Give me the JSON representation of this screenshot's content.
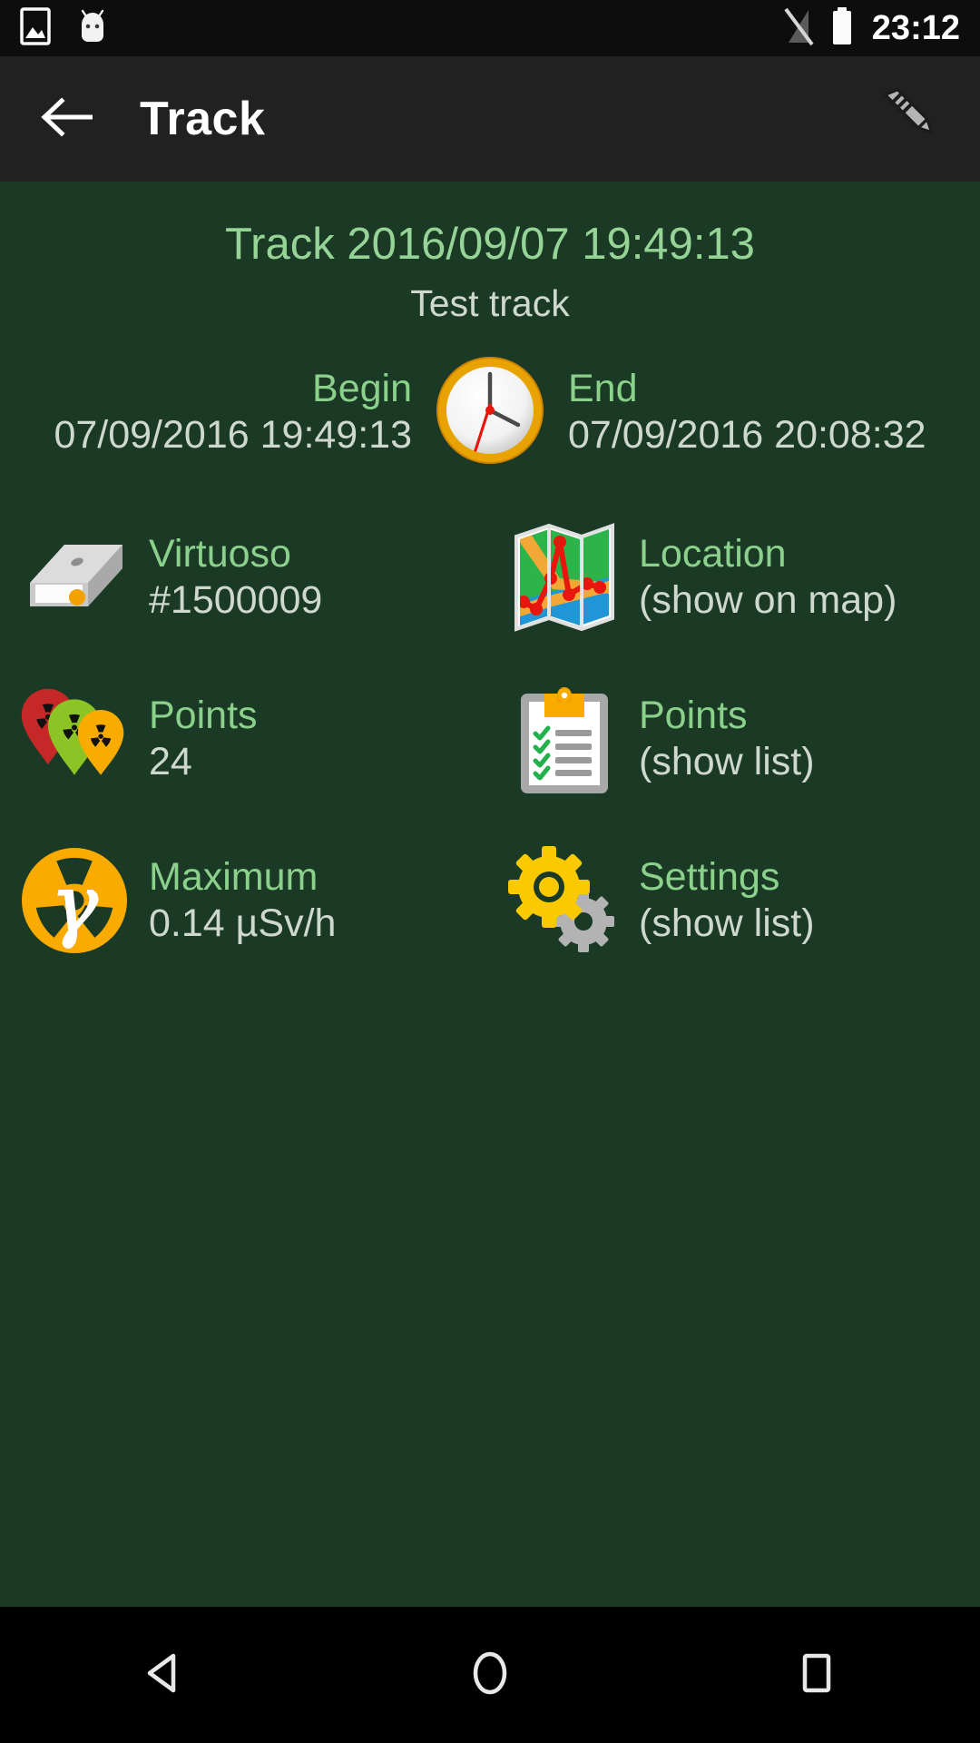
{
  "statusbar": {
    "time": "23:12",
    "icons": [
      "image-icon",
      "android-droid-icon",
      "signal-off-icon",
      "battery-icon"
    ]
  },
  "appbar": {
    "back_icon": "back-arrow-icon",
    "title": "Track",
    "edit_icon": "pencil-icon"
  },
  "track": {
    "title": "Track 2016/09/07 19:49:13",
    "subtitle": "Test track"
  },
  "times": {
    "clock_icon": "clock-icon",
    "begin_label": "Begin",
    "begin_value": "07/09/2016 19:49:13",
    "end_label": "End",
    "end_value": "07/09/2016 20:08:32"
  },
  "tiles": [
    {
      "icon": "device-icon",
      "line1": "Virtuoso",
      "line2": "#1500009"
    },
    {
      "icon": "map-icon",
      "line1": "Location",
      "line2": "(show on map)"
    },
    {
      "icon": "markers-icon",
      "line1": "Points",
      "line2": "24"
    },
    {
      "icon": "clipboard-icon",
      "line1": "Points",
      "line2": "(show list)"
    },
    {
      "icon": "gamma-icon",
      "line1": "Maximum",
      "line2": "0.14 µSv/h"
    },
    {
      "icon": "gears-icon",
      "line1": "Settings",
      "line2": "(show list)"
    }
  ],
  "navbar": {
    "back": "nav-back-icon",
    "home": "nav-home-icon",
    "recents": "nav-recents-icon"
  },
  "colors": {
    "background": "#1b3a25",
    "appbar": "#212121",
    "statusbar": "#0d0d0d",
    "label_green": "#8bd18b",
    "value_gray": "#cfd8cf",
    "title_green": "#96d396",
    "accent_orange": "#f5a800"
  }
}
